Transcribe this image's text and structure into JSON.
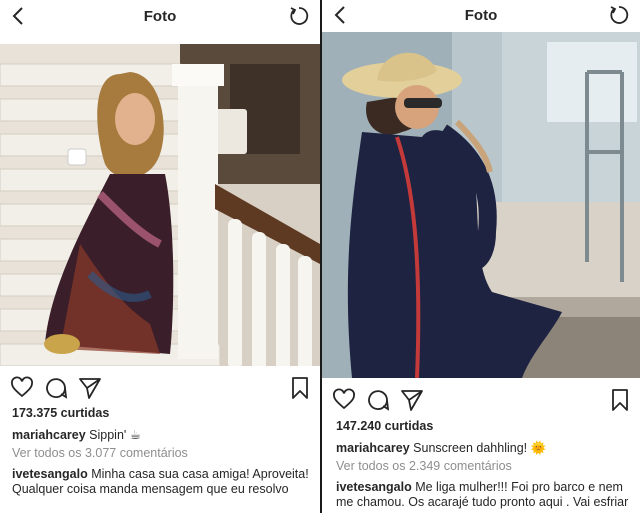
{
  "left_post": {
    "header_title": "Foto",
    "likes": "173.375 curtidas",
    "caption_user": "mariahcarey",
    "caption_text": "Sippin' ☕",
    "view_all": "Ver todos os 3.077 comentários",
    "comment_user": "ivetesangalo",
    "comment_text": "Minha casa sua casa amiga! Aproveita! Qualquer coisa manda mensagem que eu resolvo"
  },
  "right_post": {
    "header_title": "Foto",
    "likes": "147.240 curtidas",
    "caption_user": "mariahcarey",
    "caption_text": "Sunscreen dahhling! 🌞",
    "view_all": "Ver todos os 2.349 comentários",
    "comment_user": "ivetesangalo",
    "comment_text": "Me liga mulher!!! Foi pro barco e nem me chamou. Os acarajé tudo pronto aqui . Vai esfriar"
  },
  "icons": [
    "back-icon",
    "refresh-icon",
    "heart-icon",
    "comment-icon",
    "share-icon",
    "bookmark-icon"
  ],
  "colors": {
    "text": "#262626",
    "muted": "#8e8e8e",
    "divider": "#1a1a1a"
  }
}
